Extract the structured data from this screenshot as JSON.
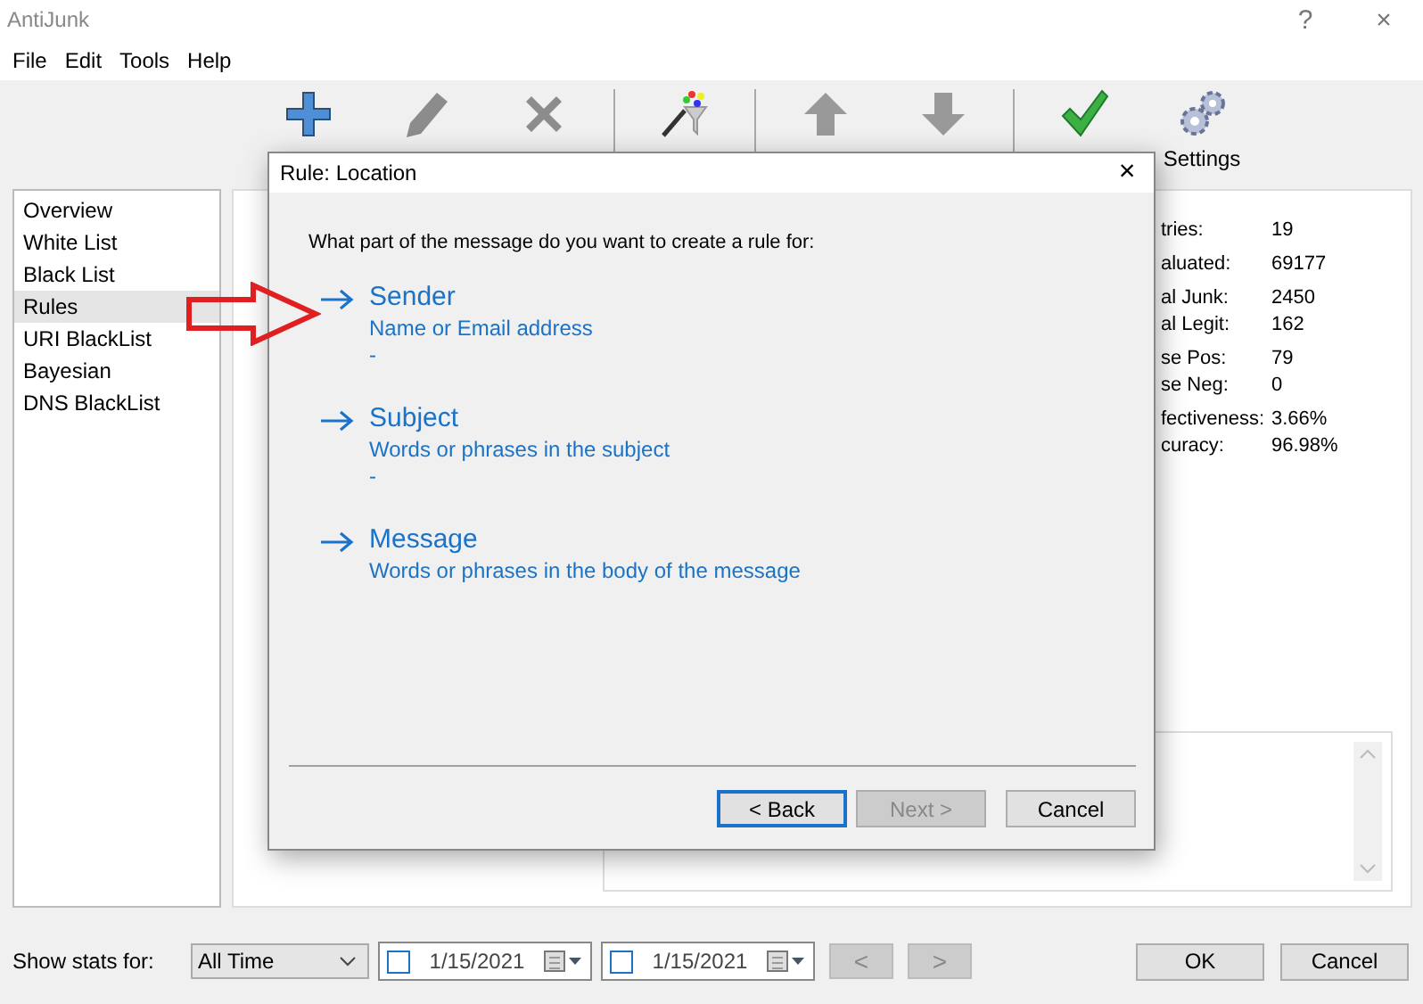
{
  "window": {
    "title": "AntiJunk",
    "buttons": [
      "?",
      "×"
    ]
  },
  "menu": [
    "File",
    "Edit",
    "Tools",
    "Help"
  ],
  "toolbar": [
    {
      "kind": "add",
      "disabled": false
    },
    {
      "kind": "edit",
      "disabled": true
    },
    {
      "kind": "delete",
      "disabled": true
    },
    {
      "kind": "separator"
    },
    {
      "kind": "wizard"
    },
    {
      "kind": "separator"
    },
    {
      "kind": "up",
      "disabled": true
    },
    {
      "kind": "down",
      "disabled": true
    },
    {
      "kind": "separator"
    },
    {
      "kind": "test",
      "disabled": false
    },
    {
      "kind": "settings",
      "label": "Settings"
    }
  ],
  "sidebar": {
    "items": [
      {
        "label": "Overview",
        "selected": false
      },
      {
        "label": "White List",
        "selected": false
      },
      {
        "label": "Black List",
        "selected": false
      },
      {
        "label": "Rules",
        "selected": true
      },
      {
        "label": "URI BlackList",
        "selected": false
      },
      {
        "label": "Bayesian",
        "selected": false
      },
      {
        "label": "DNS BlackList",
        "selected": false
      }
    ]
  },
  "stats": [
    [
      {
        "label": "tries:",
        "value": "19"
      }
    ],
    [
      {
        "label": "aluated:",
        "value": "69177"
      }
    ],
    [
      {
        "label": "al Junk:",
        "value": "2450"
      },
      {
        "label": "al Legit:",
        "value": "162"
      }
    ],
    [
      {
        "label": "se Pos:",
        "value": "79"
      },
      {
        "label": "se Neg:",
        "value": "0"
      }
    ],
    [
      {
        "label": "fectiveness:",
        "value": "3.66%"
      },
      {
        "label": "curacy:",
        "value": "96.98%"
      }
    ]
  ],
  "bottom_bar": {
    "label": "Show stats for:",
    "range": "All Time",
    "dates": [
      {
        "value": "1/15/2021",
        "checked": false
      },
      {
        "value": "1/15/2021",
        "checked": false
      }
    ],
    "nav": [
      {
        "label": "<",
        "disabled": true
      },
      {
        "label": ">",
        "disabled": true
      }
    ],
    "buttons": [
      "OK",
      "Cancel"
    ]
  },
  "dialog": {
    "title": "Rule: Location",
    "close": "×",
    "prompt": "What part of the message do you want to create a rule for:",
    "options": [
      {
        "title": "Sender",
        "subtitle": "Name or Email address",
        "detail": "-"
      },
      {
        "title": "Subject",
        "subtitle": "Words or phrases in the subject",
        "detail": "-"
      },
      {
        "title": "Message",
        "subtitle": "Words or phrases in the body of the message"
      }
    ],
    "buttons": [
      {
        "label": "< Back",
        "disabled": false,
        "focused": true
      },
      {
        "label": "Next >",
        "disabled": true,
        "focused": false
      },
      {
        "label": "Cancel",
        "disabled": false,
        "focused": false
      }
    ]
  }
}
